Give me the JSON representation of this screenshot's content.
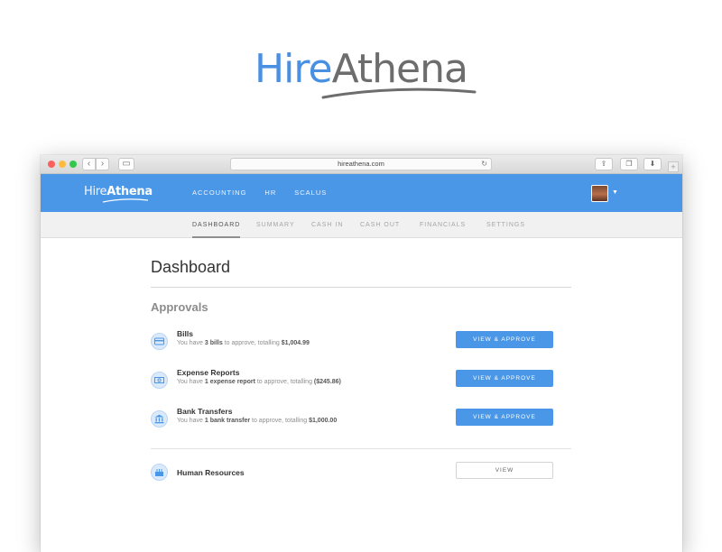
{
  "brand": {
    "hire": "Hire",
    "athena": "Athena",
    "hire_color": "#4a90e2",
    "athena_color": "#6d6d6d"
  },
  "browser": {
    "url": "hireathena.com",
    "icons": {
      "back": "chevron-left-icon",
      "forward": "chevron-right-icon",
      "sidebar": "sidebar-icon",
      "reload": "reload-icon",
      "share": "share-icon",
      "tabs": "tabs-icon",
      "download": "download-icon",
      "new_tab": "plus-icon"
    }
  },
  "header": {
    "logo_hire": "Hire",
    "logo_athena": "Athena",
    "nav": [
      "ACCOUNTING",
      "HR",
      "SCALUS"
    ],
    "accent": "#4a97e8"
  },
  "subnav": {
    "tabs": [
      "DASHBOARD",
      "SUMMARY",
      "CASH IN",
      "CASH OUT",
      "FINANCIALS",
      "SETTINGS"
    ],
    "active": "DASHBOARD"
  },
  "main": {
    "title": "Dashboard",
    "approvals_title": "Approvals",
    "approvals": [
      {
        "title": "Bills",
        "pre": "You have ",
        "count": "3 bills",
        "mid": " to approve, totalling ",
        "amount": "$1,004.99",
        "button": "VIEW & APPROVE",
        "icon": "credit-card-icon"
      },
      {
        "title": "Expense Reports",
        "pre": "You have ",
        "count": "1 expense report",
        "mid": " to approve, totalling ",
        "amount": "($245.86)",
        "button": "VIEW & APPROVE",
        "icon": "cash-icon"
      },
      {
        "title": "Bank Transfers",
        "pre": "You have ",
        "count": "1 bank transfer",
        "mid": " to approve, totalling ",
        "amount": "$1,000.00",
        "button": "VIEW & APPROVE",
        "icon": "bank-icon"
      }
    ],
    "hr": {
      "title": "Human Resources",
      "button": "VIEW",
      "icon": "cake-icon"
    }
  }
}
